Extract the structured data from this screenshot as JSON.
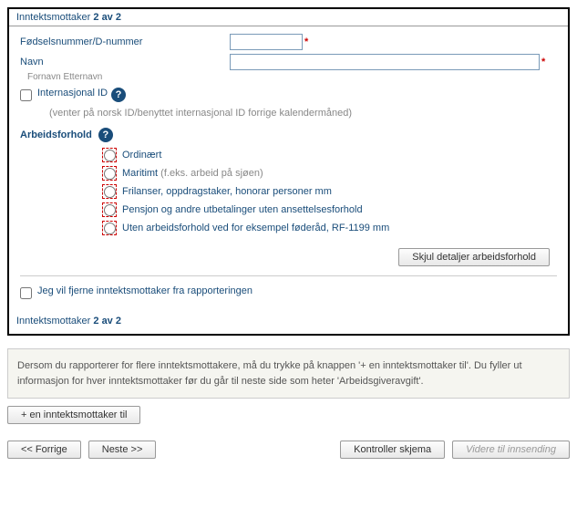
{
  "header": {
    "prefix": "Inntektsmottaker",
    "count": "2 av 2"
  },
  "form": {
    "fnr_label": "Fødselsnummer/D-nummer",
    "navn_label": "Navn",
    "navn_hint": "Fornavn Etternavn",
    "intl_id_label": "Internasjonal ID",
    "intl_id_hint": "(venter på norsk ID/benyttet internasjonal ID forrige kalendermåned)"
  },
  "arbeidsforhold": {
    "title": "Arbeidsforhold",
    "options": [
      {
        "label": "Ordinært",
        "hint": ""
      },
      {
        "label": "Maritimt",
        "hint": "(f.eks. arbeid på sjøen)"
      },
      {
        "label": "Frilanser, oppdragstaker, honorar personer mm",
        "hint": ""
      },
      {
        "label": "Pensjon og andre utbetalinger uten ansettelsesforhold",
        "hint": ""
      },
      {
        "label": "Uten arbeidsforhold ved for eksempel føderåd, RF-1199 mm",
        "hint": ""
      }
    ],
    "toggle_button": "Skjul detaljer arbeidsforhold"
  },
  "remove_label": "Jeg vil fjerne inntektsmottaker fra rapporteringen",
  "bottom_counter": {
    "prefix": "Inntektsmottaker",
    "count": "2 av 2"
  },
  "info_text": "Dersom du rapporterer for flere inntektsmottakere, må du trykke på knappen '+ en inntektsmottaker til'. Du fyller ut informasjon for hver inntektsmottaker før du går til neste side som heter 'Arbeidsgiveravgift'.",
  "add_button": "+ en inntektsmottaker til",
  "nav": {
    "prev": "<< Forrige",
    "next": "Neste >>",
    "control": "Kontroller skjema",
    "submit": "Videre til innsending"
  }
}
